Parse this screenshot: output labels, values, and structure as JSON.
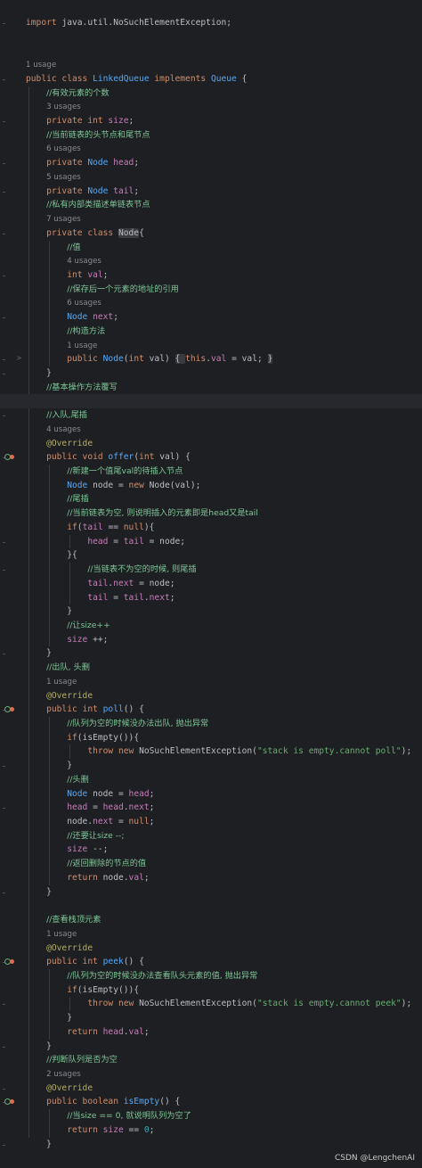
{
  "editor": {
    "lines": [
      [
        [
          "kw",
          "import "
        ],
        [
          "",
          "java.util.NoSuchElementException;"
        ]
      ],
      [],
      [],
      [
        [
          "usage",
          "1 usage"
        ]
      ],
      [
        [
          "kw",
          "public class "
        ],
        [
          "fn",
          "LinkedQueue "
        ],
        [
          "kw",
          "implements "
        ],
        [
          "cls2",
          "Queue "
        ],
        [
          "",
          "{"
        ]
      ],
      [
        [
          "",
          "    "
        ],
        [
          "cmt",
          "//有效元素的个数"
        ]
      ],
      [
        [
          "",
          "    "
        ],
        [
          "usage",
          "3 usages"
        ]
      ],
      [
        [
          "",
          "    "
        ],
        [
          "kw",
          "private int "
        ],
        [
          "fld",
          "size"
        ],
        [
          "",
          ";"
        ]
      ],
      [
        [
          "",
          "    "
        ],
        [
          "cmt",
          "//当前链表的头节点和尾节点"
        ]
      ],
      [
        [
          "",
          "    "
        ],
        [
          "usage",
          "6 usages"
        ]
      ],
      [
        [
          "",
          "    "
        ],
        [
          "kw",
          "private "
        ],
        [
          "cls2",
          "Node "
        ],
        [
          "fld",
          "head"
        ],
        [
          "",
          ";"
        ]
      ],
      [
        [
          "",
          "    "
        ],
        [
          "usage",
          "5 usages"
        ]
      ],
      [
        [
          "",
          "    "
        ],
        [
          "kw",
          "private "
        ],
        [
          "cls2",
          "Node "
        ],
        [
          "fld",
          "tail"
        ],
        [
          "",
          ";"
        ]
      ],
      [
        [
          "",
          "    "
        ],
        [
          "cmt",
          "//私有内部类描述单链表节点"
        ]
      ],
      [
        [
          "",
          "    "
        ],
        [
          "usage",
          "7 usages"
        ]
      ],
      [
        [
          "",
          "    "
        ],
        [
          "kw",
          "private class "
        ],
        [
          "hlbox",
          "Node"
        ],
        [
          "",
          "{"
        ]
      ],
      [
        [
          "",
          "        "
        ],
        [
          "cmt",
          "//值"
        ]
      ],
      [
        [
          "",
          "        "
        ],
        [
          "usage",
          "4 usages"
        ]
      ],
      [
        [
          "",
          "        "
        ],
        [
          "kw",
          "int "
        ],
        [
          "fld",
          "val"
        ],
        [
          "",
          ";"
        ]
      ],
      [
        [
          "",
          "        "
        ],
        [
          "cmt",
          "//保存后一个元素的地址的引用"
        ]
      ],
      [
        [
          "",
          "        "
        ],
        [
          "usage",
          "6 usages"
        ]
      ],
      [
        [
          "",
          "        "
        ],
        [
          "cls2",
          "Node "
        ],
        [
          "fld",
          "next"
        ],
        [
          "",
          ";"
        ]
      ],
      [
        [
          "",
          "        "
        ],
        [
          "cmt",
          "//构造方法"
        ]
      ],
      [
        [
          "",
          "        "
        ],
        [
          "usage",
          "1 usage"
        ]
      ],
      [
        [
          "",
          "        "
        ],
        [
          "kw",
          "public "
        ],
        [
          "fn",
          "Node"
        ],
        [
          "",
          "("
        ],
        [
          "kw",
          "int "
        ],
        [
          "",
          "val) "
        ],
        [
          "hlbox",
          "{ "
        ],
        [
          "kw",
          "this"
        ],
        [
          "",
          "."
        ],
        [
          "fld",
          "val"
        ],
        [
          "",
          " = val; "
        ],
        [
          "hlbox",
          "}"
        ]
      ],
      [
        [
          "",
          "    }"
        ]
      ],
      [
        [
          "",
          "    "
        ],
        [
          "cmt",
          "//基本操作方法覆写"
        ]
      ],
      [
        [
          "hl",
          ""
        ]
      ],
      [
        [
          "",
          "    "
        ],
        [
          "cmt",
          "//入队,尾插"
        ]
      ],
      [
        [
          "",
          "    "
        ],
        [
          "usage",
          "4 usages"
        ]
      ],
      [
        [
          "",
          "    "
        ],
        [
          "ann",
          "@Override"
        ]
      ],
      [
        [
          "",
          "    "
        ],
        [
          "kw",
          "public void "
        ],
        [
          "fn",
          "offer"
        ],
        [
          "",
          "("
        ],
        [
          "kw",
          "int "
        ],
        [
          "",
          "val) {"
        ]
      ],
      [
        [
          "",
          "        "
        ],
        [
          "cmt",
          "//新建一个值尾val的待插入节点"
        ]
      ],
      [
        [
          "",
          "        "
        ],
        [
          "cls2",
          "Node "
        ],
        [
          "",
          "node = "
        ],
        [
          "kw",
          "new "
        ],
        [
          "",
          "Node(val);"
        ]
      ],
      [
        [
          "",
          "        "
        ],
        [
          "cmt",
          "//尾插"
        ]
      ],
      [
        [
          "",
          "        "
        ],
        [
          "cmt",
          "//当前链表为空, 则说明插入的元素即是head又是tail"
        ]
      ],
      [
        [
          "",
          "        "
        ],
        [
          "kw",
          "if"
        ],
        [
          "",
          "("
        ],
        [
          "fld",
          "tail"
        ],
        [
          "",
          " == "
        ],
        [
          "kw",
          "null"
        ],
        [
          "",
          "){"
        ]
      ],
      [
        [
          "",
          "            "
        ],
        [
          "fld",
          "head"
        ],
        [
          "",
          " = "
        ],
        [
          "fld",
          "tail"
        ],
        [
          "",
          " = node;"
        ]
      ],
      [
        [
          "",
          "        }{"
        ]
      ],
      [
        [
          "",
          "            "
        ],
        [
          "cmt",
          "//当链表不为空的时候, 则尾插"
        ]
      ],
      [
        [
          "",
          "            "
        ],
        [
          "fld",
          "tail"
        ],
        [
          "",
          "."
        ],
        [
          "fld",
          "next"
        ],
        [
          "",
          " = node;"
        ]
      ],
      [
        [
          "",
          "            "
        ],
        [
          "fld",
          "tail"
        ],
        [
          "",
          " = "
        ],
        [
          "fld",
          "tail"
        ],
        [
          "",
          "."
        ],
        [
          "fld",
          "next"
        ],
        [
          "",
          ";"
        ]
      ],
      [
        [
          "",
          "        }"
        ]
      ],
      [
        [
          "",
          "        "
        ],
        [
          "cmt",
          "//让size++"
        ]
      ],
      [
        [
          "",
          "        "
        ],
        [
          "fld",
          "size"
        ],
        [
          "",
          " ++;"
        ]
      ],
      [
        [
          "",
          "    }"
        ]
      ],
      [
        [
          "",
          "    "
        ],
        [
          "cmt",
          "//出队, 头删"
        ]
      ],
      [
        [
          "",
          "    "
        ],
        [
          "usage",
          "1 usage"
        ]
      ],
      [
        [
          "",
          "    "
        ],
        [
          "ann",
          "@Override"
        ]
      ],
      [
        [
          "",
          "    "
        ],
        [
          "kw",
          "public int "
        ],
        [
          "fn",
          "poll"
        ],
        [
          "",
          "() {"
        ]
      ],
      [
        [
          "",
          "        "
        ],
        [
          "cmt",
          "//队列为空的时候没办法出队, 抛出异常"
        ]
      ],
      [
        [
          "",
          "        "
        ],
        [
          "kw",
          "if"
        ],
        [
          "",
          "(isEmpty()){"
        ]
      ],
      [
        [
          "",
          "            "
        ],
        [
          "kw",
          "throw new "
        ],
        [
          "",
          "NoSuchElementException("
        ],
        [
          "str",
          "\"stack is empty.cannot poll\""
        ],
        [
          "",
          ");"
        ]
      ],
      [
        [
          "",
          "        }"
        ]
      ],
      [
        [
          "",
          "        "
        ],
        [
          "cmt",
          "//头删"
        ]
      ],
      [
        [
          "",
          "        "
        ],
        [
          "cls2",
          "Node "
        ],
        [
          "",
          "node = "
        ],
        [
          "fld",
          "head"
        ],
        [
          "",
          ";"
        ]
      ],
      [
        [
          "",
          "        "
        ],
        [
          "fld",
          "head"
        ],
        [
          "",
          " = "
        ],
        [
          "fld",
          "head"
        ],
        [
          "",
          "."
        ],
        [
          "fld",
          "next"
        ],
        [
          "",
          ";"
        ]
      ],
      [
        [
          "",
          "        node."
        ],
        [
          "fld",
          "next"
        ],
        [
          "",
          " = "
        ],
        [
          "kw",
          "null"
        ],
        [
          "",
          ";"
        ]
      ],
      [
        [
          "",
          "        "
        ],
        [
          "cmt",
          "//还要让size --;"
        ]
      ],
      [
        [
          "",
          "        "
        ],
        [
          "fld",
          "size"
        ],
        [
          "",
          " --;"
        ]
      ],
      [
        [
          "",
          "        "
        ],
        [
          "cmt",
          "//返回删除的节点的值"
        ]
      ],
      [
        [
          "",
          "        "
        ],
        [
          "kw",
          "return "
        ],
        [
          "",
          "node."
        ],
        [
          "fld",
          "val"
        ],
        [
          "",
          ";"
        ]
      ],
      [
        [
          "",
          "    }"
        ]
      ],
      [],
      [
        [
          "",
          "    "
        ],
        [
          "cmt",
          "//查看栈顶元素"
        ]
      ],
      [
        [
          "",
          "    "
        ],
        [
          "usage",
          "1 usage"
        ]
      ],
      [
        [
          "",
          "    "
        ],
        [
          "ann",
          "@Override"
        ]
      ],
      [
        [
          "",
          "    "
        ],
        [
          "kw",
          "public int "
        ],
        [
          "fn",
          "peek"
        ],
        [
          "",
          "() {"
        ]
      ],
      [
        [
          "",
          "        "
        ],
        [
          "cmt",
          "//队列为空的时候没办法查看队头元素的值, 抛出异常"
        ]
      ],
      [
        [
          "",
          "        "
        ],
        [
          "kw",
          "if"
        ],
        [
          "",
          "(isEmpty()){"
        ]
      ],
      [
        [
          "",
          "            "
        ],
        [
          "kw",
          "throw new "
        ],
        [
          "",
          "NoSuchElementException("
        ],
        [
          "str",
          "\"stack is empty.cannot peek\""
        ],
        [
          "",
          ");"
        ]
      ],
      [
        [
          "",
          "        }"
        ]
      ],
      [
        [
          "",
          "        "
        ],
        [
          "kw",
          "return "
        ],
        [
          "fld",
          "head"
        ],
        [
          "",
          "."
        ],
        [
          "fld",
          "val"
        ],
        [
          "",
          ";"
        ]
      ],
      [
        [
          "",
          "    }"
        ]
      ],
      [
        [
          "",
          "    "
        ],
        [
          "cmt",
          "//判断队列是否为空"
        ]
      ],
      [
        [
          "",
          "    "
        ],
        [
          "usage",
          "2 usages"
        ]
      ],
      [
        [
          "",
          "    "
        ],
        [
          "ann",
          "@Override"
        ]
      ],
      [
        [
          "",
          "    "
        ],
        [
          "kw",
          "public boolean "
        ],
        [
          "fn",
          "isEmpty"
        ],
        [
          "",
          "() {"
        ]
      ],
      [
        [
          "",
          "        "
        ],
        [
          "cmt",
          "//当size == 0, 就说明队列为空了"
        ]
      ],
      [
        [
          "",
          "        "
        ],
        [
          "kw",
          "return "
        ],
        [
          "fld",
          "size"
        ],
        [
          "",
          " == "
        ],
        [
          "num",
          "0"
        ],
        [
          "",
          ";"
        ]
      ],
      [
        [
          "",
          "    }"
        ]
      ]
    ]
  },
  "gutter_icons": {
    "fold_icon": ">",
    "override_icon": "override-implementing-icon"
  },
  "watermark": "CSDN @LengchenAI",
  "colors": {
    "background": "#1e1f22",
    "keyword": "#cf8e6d",
    "comment": "#7ec699",
    "string": "#6aab73",
    "field": "#c77dbb",
    "method": "#56a8f5",
    "annotation": "#b3ae60"
  }
}
